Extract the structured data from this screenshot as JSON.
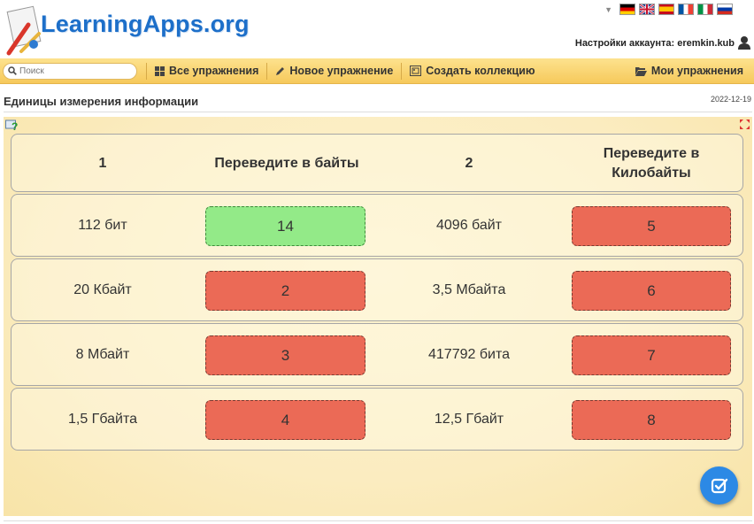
{
  "header": {
    "logo_text": "LearningApps.org",
    "account_label": "Настройки аккаунта: eremkin.kub",
    "languages": [
      "de-flag",
      "en-flag",
      "es-flag",
      "fr-flag",
      "it-flag",
      "ru-flag"
    ]
  },
  "toolbar": {
    "search_placeholder": "Поиск",
    "all_exercises": "Все упражнения",
    "new_exercise": "Новое упражнение",
    "create_collection": "Создать коллекцию",
    "my_exercises": "Мои упражнения"
  },
  "page": {
    "title": "Единицы измерения информации",
    "date": "2022-12-19"
  },
  "table": {
    "header": {
      "col1": "1",
      "col2": "Переведите в байты",
      "col3": "2",
      "col4_line1": "Переведите в",
      "col4_line2": "Килобайты"
    },
    "rows": [
      {
        "q1": "112 бит",
        "a1": "14",
        "q2": "4096 байт",
        "a2": "5"
      },
      {
        "q1": "20 Кбайт",
        "a1": "2",
        "q2": "3,5 Мбайта",
        "a2": "6"
      },
      {
        "q1": "8 Мбайт",
        "a1": "3",
        "q2": "417792 бита",
        "a2": "7"
      },
      {
        "q1": "1,5 Гбайта",
        "a1": "4",
        "q2": "12,5 Гбайт",
        "a2": "8"
      }
    ]
  },
  "colors": {
    "correct": "#93ea88",
    "wrong": "#eb6a56",
    "toolbar": "#f6c95b",
    "brand": "#1d6fc9"
  }
}
